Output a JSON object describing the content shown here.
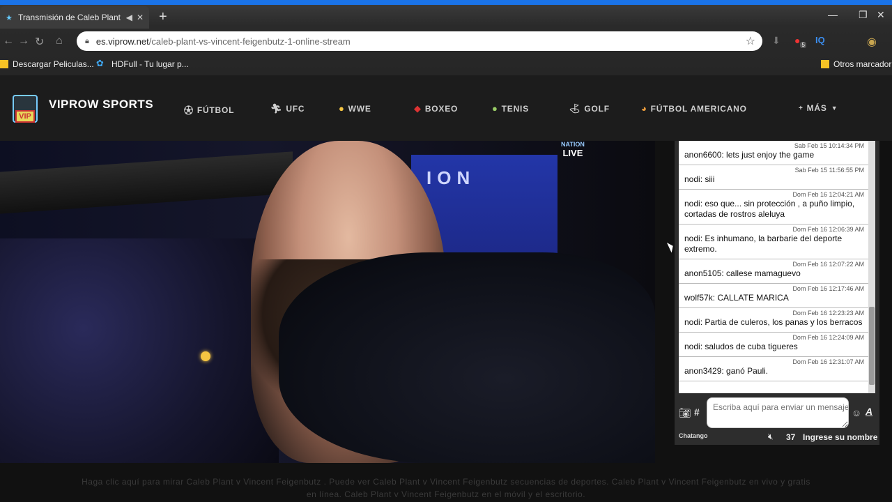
{
  "browser": {
    "tab_title": "Transmisión de Caleb Plant v",
    "url_host": "es.viprow.net",
    "url_path": "/caleb-plant-vs-vincent-feigenbutz-1-online-stream",
    "extension_badge": "5",
    "extension_label": "IQ",
    "bookmarks": [
      {
        "label": "Descargar Peliculas..."
      },
      {
        "label": "HDFull - Tu lugar p..."
      },
      {
        "label": "Otros marcador"
      }
    ]
  },
  "site": {
    "logo_text": "VIP",
    "name": "VIPROW SPORTS",
    "menu": [
      {
        "label": "FÚTBOL"
      },
      {
        "label": "UFC"
      },
      {
        "label": "WWE"
      },
      {
        "label": "BOXEO"
      },
      {
        "label": "TENIS"
      },
      {
        "label": "GOLF"
      },
      {
        "label": "FÚTBOL AMERICANO"
      },
      {
        "label": "MÁS"
      }
    ]
  },
  "video": {
    "banner_text": "ION",
    "overlay_top": "NATION",
    "overlay_live": "LIVE"
  },
  "chat": {
    "messages": [
      {
        "ts": "Sab Feb 15 10:14:34 PM",
        "text": "anon6600: lets just enjoy the game"
      },
      {
        "ts": "Sab Feb 15 11:56:55 PM",
        "text": "nodi: siii"
      },
      {
        "ts": "Dom Feb 16 12:04:21 AM",
        "text": "nodi: eso que... sin protección , a puño limpio, cortadas de rostros aleluya"
      },
      {
        "ts": "Dom Feb 16 12:06:39 AM",
        "text": "nodi: Es inhumano, la barbarie del deporte extremo."
      },
      {
        "ts": "Dom Feb 16 12:07:22 AM",
        "text": "anon5105: callese mamaguevo"
      },
      {
        "ts": "Dom Feb 16 12:17:46 AM",
        "text": "wolf57k: CALLATE MARICA"
      },
      {
        "ts": "Dom Feb 16 12:23:23 AM",
        "text": "nodi: Partia de culeros, los panas y los berracos"
      },
      {
        "ts": "Dom Feb 16 12:24:09 AM",
        "text": "nodi: saludos de cuba tigueres"
      },
      {
        "ts": "Dom Feb 16 12:31:07 AM",
        "text": "anon3429: ganó Pauli."
      }
    ],
    "input_placeholder": "Escriba aquí para enviar un mensaje",
    "brand": "Chatango",
    "user_count": "37",
    "login_label": "Ingrese su nombre"
  },
  "footer": {
    "line1": "Haga clic aquí para mirar Caleb Plant v Vincent Feigenbutz . Puede ver Caleb Plant v Vincent Feigenbutz secuencias de deportes. Caleb Plant v Vincent Feigenbutz en vivo y gratis",
    "line2": "en línea. Caleb Plant v Vincent Feigenbutz en el móvil y el escritorio."
  }
}
